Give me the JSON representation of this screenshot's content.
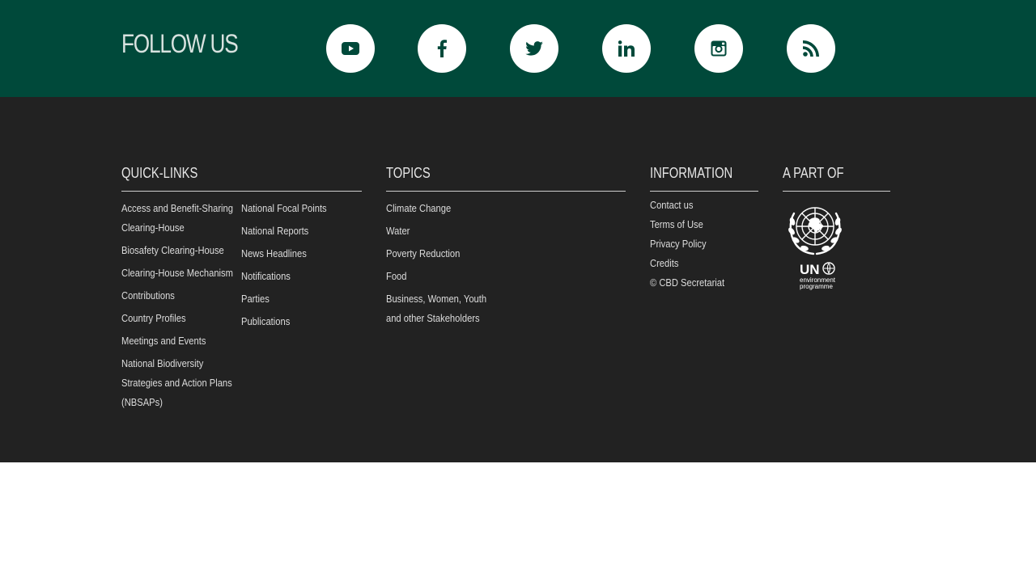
{
  "follow": {
    "title": "FOLLOW US",
    "icons": [
      "youtube-icon",
      "facebook-icon",
      "twitter-icon",
      "linkedin-icon",
      "instagram-icon",
      "rss-icon"
    ]
  },
  "colors": {
    "follow_bg": "#00493a",
    "footer_bg": "#222222",
    "icon_fill": "#00493a",
    "text": "#dcdcdc"
  },
  "footer": {
    "quick_links": {
      "title": "QUICK-LINKS",
      "col1": [
        "Access and Benefit-Sharing Clearing-House",
        "Biosafety Clearing-House",
        "Clearing-House Mechanism",
        "Contributions",
        "Country Profiles",
        "Meetings and Events",
        "National Biodiversity Strategies and Action Plans (NBSAPs)"
      ],
      "col2": [
        "National Focal Points",
        "National Reports",
        "News Headlines",
        "Notifications",
        "Parties",
        "Publications"
      ]
    },
    "topics": {
      "title": "TOPICS",
      "items": [
        "Climate Change",
        "Water",
        "Poverty Reduction",
        "Food",
        "Business, Women, Youth and other Stakeholders"
      ]
    },
    "information": {
      "title": "INFORMATION",
      "items": [
        "Contact us",
        "Terms of Use",
        "Privacy Policy",
        "Credits"
      ],
      "copyright": "© CBD Secretariat"
    },
    "part_of": {
      "title": "A PART OF",
      "unep_line1": "UN",
      "unep_line2": "environment",
      "unep_line3": "programme"
    }
  }
}
